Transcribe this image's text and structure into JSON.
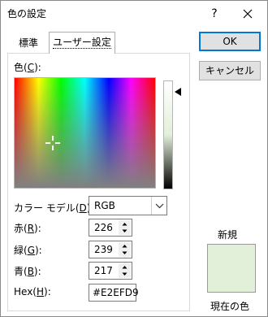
{
  "window": {
    "title": "色の設定",
    "help_glyph": "?"
  },
  "tabs": [
    {
      "label": "標準",
      "active": false
    },
    {
      "label": "ユーザー設定",
      "active": true
    }
  ],
  "buttons": {
    "ok": "OK",
    "cancel": "キャンセル"
  },
  "color_label": {
    "pre": "色(",
    "key": "C",
    "post": "):"
  },
  "model": {
    "label_pre": "カラー モデル(",
    "label_key": "D",
    "label_post": "):",
    "value": "RGB"
  },
  "fields": {
    "red": {
      "pre": "赤(",
      "key": "R",
      "post": "):",
      "value": "226"
    },
    "green": {
      "pre": "緑(",
      "key": "G",
      "post": "):",
      "value": "239"
    },
    "blue": {
      "pre": "青(",
      "key": "B",
      "post": "):",
      "value": "217"
    },
    "hex": {
      "pre": "Hex(",
      "key": "H",
      "post": "):",
      "value": "#E2EFD9"
    }
  },
  "preview": {
    "new_label": "新規",
    "current_label": "現在の色",
    "new_color": "#e2efd9",
    "current_color": "#e2efd9"
  },
  "colors": {
    "accent": "#0078d7",
    "button_face": "#e1e1e1"
  },
  "icons": {
    "close": "close-icon",
    "crosshair": "crosshair-icon",
    "slider_arrow": "triangle-left-icon",
    "dropdown": "chevron-down-icon",
    "spin_up": "spin-up-icon",
    "spin_down": "spin-down-icon"
  }
}
